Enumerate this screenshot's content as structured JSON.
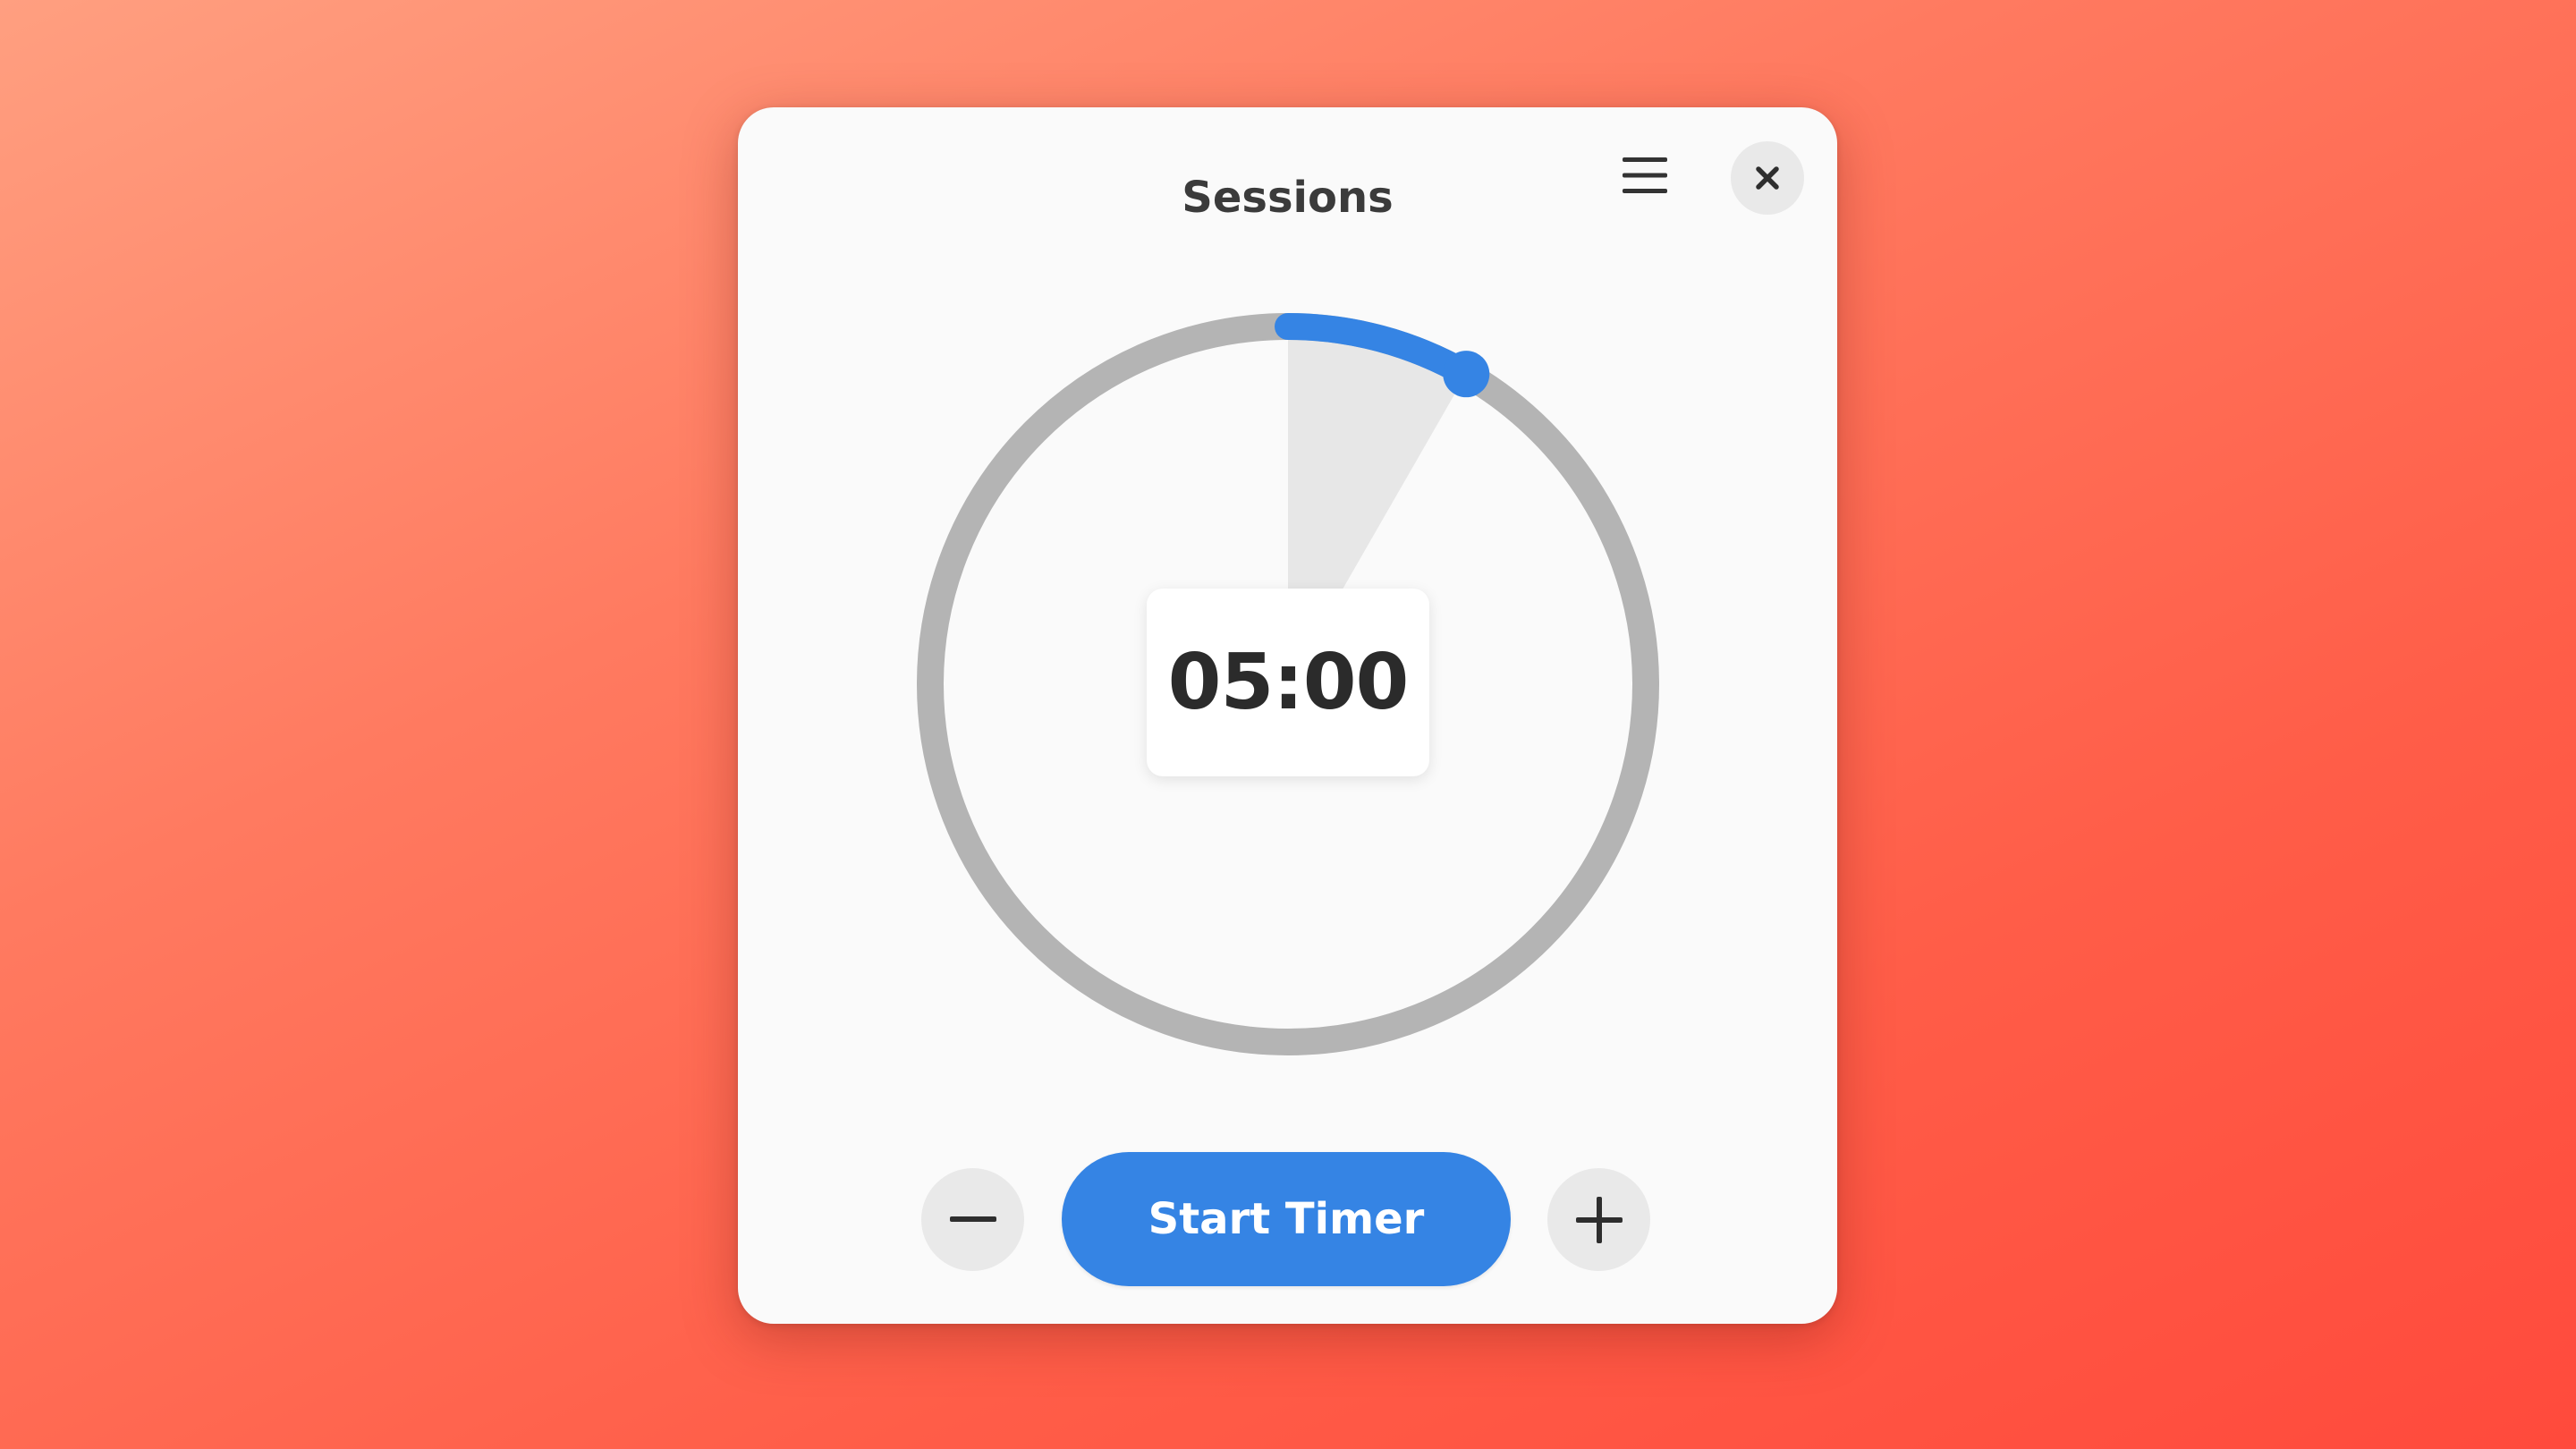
{
  "window": {
    "title": "Sessions"
  },
  "header": {
    "menu_icon": "hamburger-menu-icon",
    "close_icon": "close-icon"
  },
  "timer": {
    "display": "05:00",
    "progress_fraction": 0.083,
    "accent_color": "#3584e4",
    "track_color": "#b4b4b4"
  },
  "controls": {
    "decrease_icon": "minus-icon",
    "start_label": "Start Timer",
    "increase_icon": "plus-icon"
  }
}
